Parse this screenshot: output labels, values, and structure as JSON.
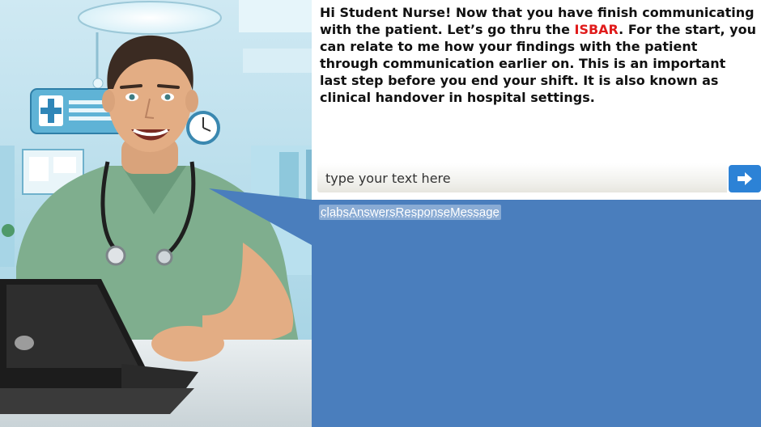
{
  "chat": {
    "instruction_part1": "Hi Student Nurse! Now that you have finish communicating with the patient. Let’s go thru the ",
    "instruction_highlight": "ISBAR",
    "instruction_part2": ". For the start, you can relate to me how your findings with the patient through communication earlier on. This is an important last step before you end your shift. It is also known as clinical handover in hospital settings.",
    "highlight_color": "#e01b1b"
  },
  "input": {
    "placeholder": "type your text here",
    "value": ""
  },
  "send_button": {
    "icon": "arrow-right-icon",
    "color": "#2c82d6"
  },
  "response": {
    "message": "clabsAnswersResponseMessage",
    "panel_color": "#4a7ebd"
  }
}
